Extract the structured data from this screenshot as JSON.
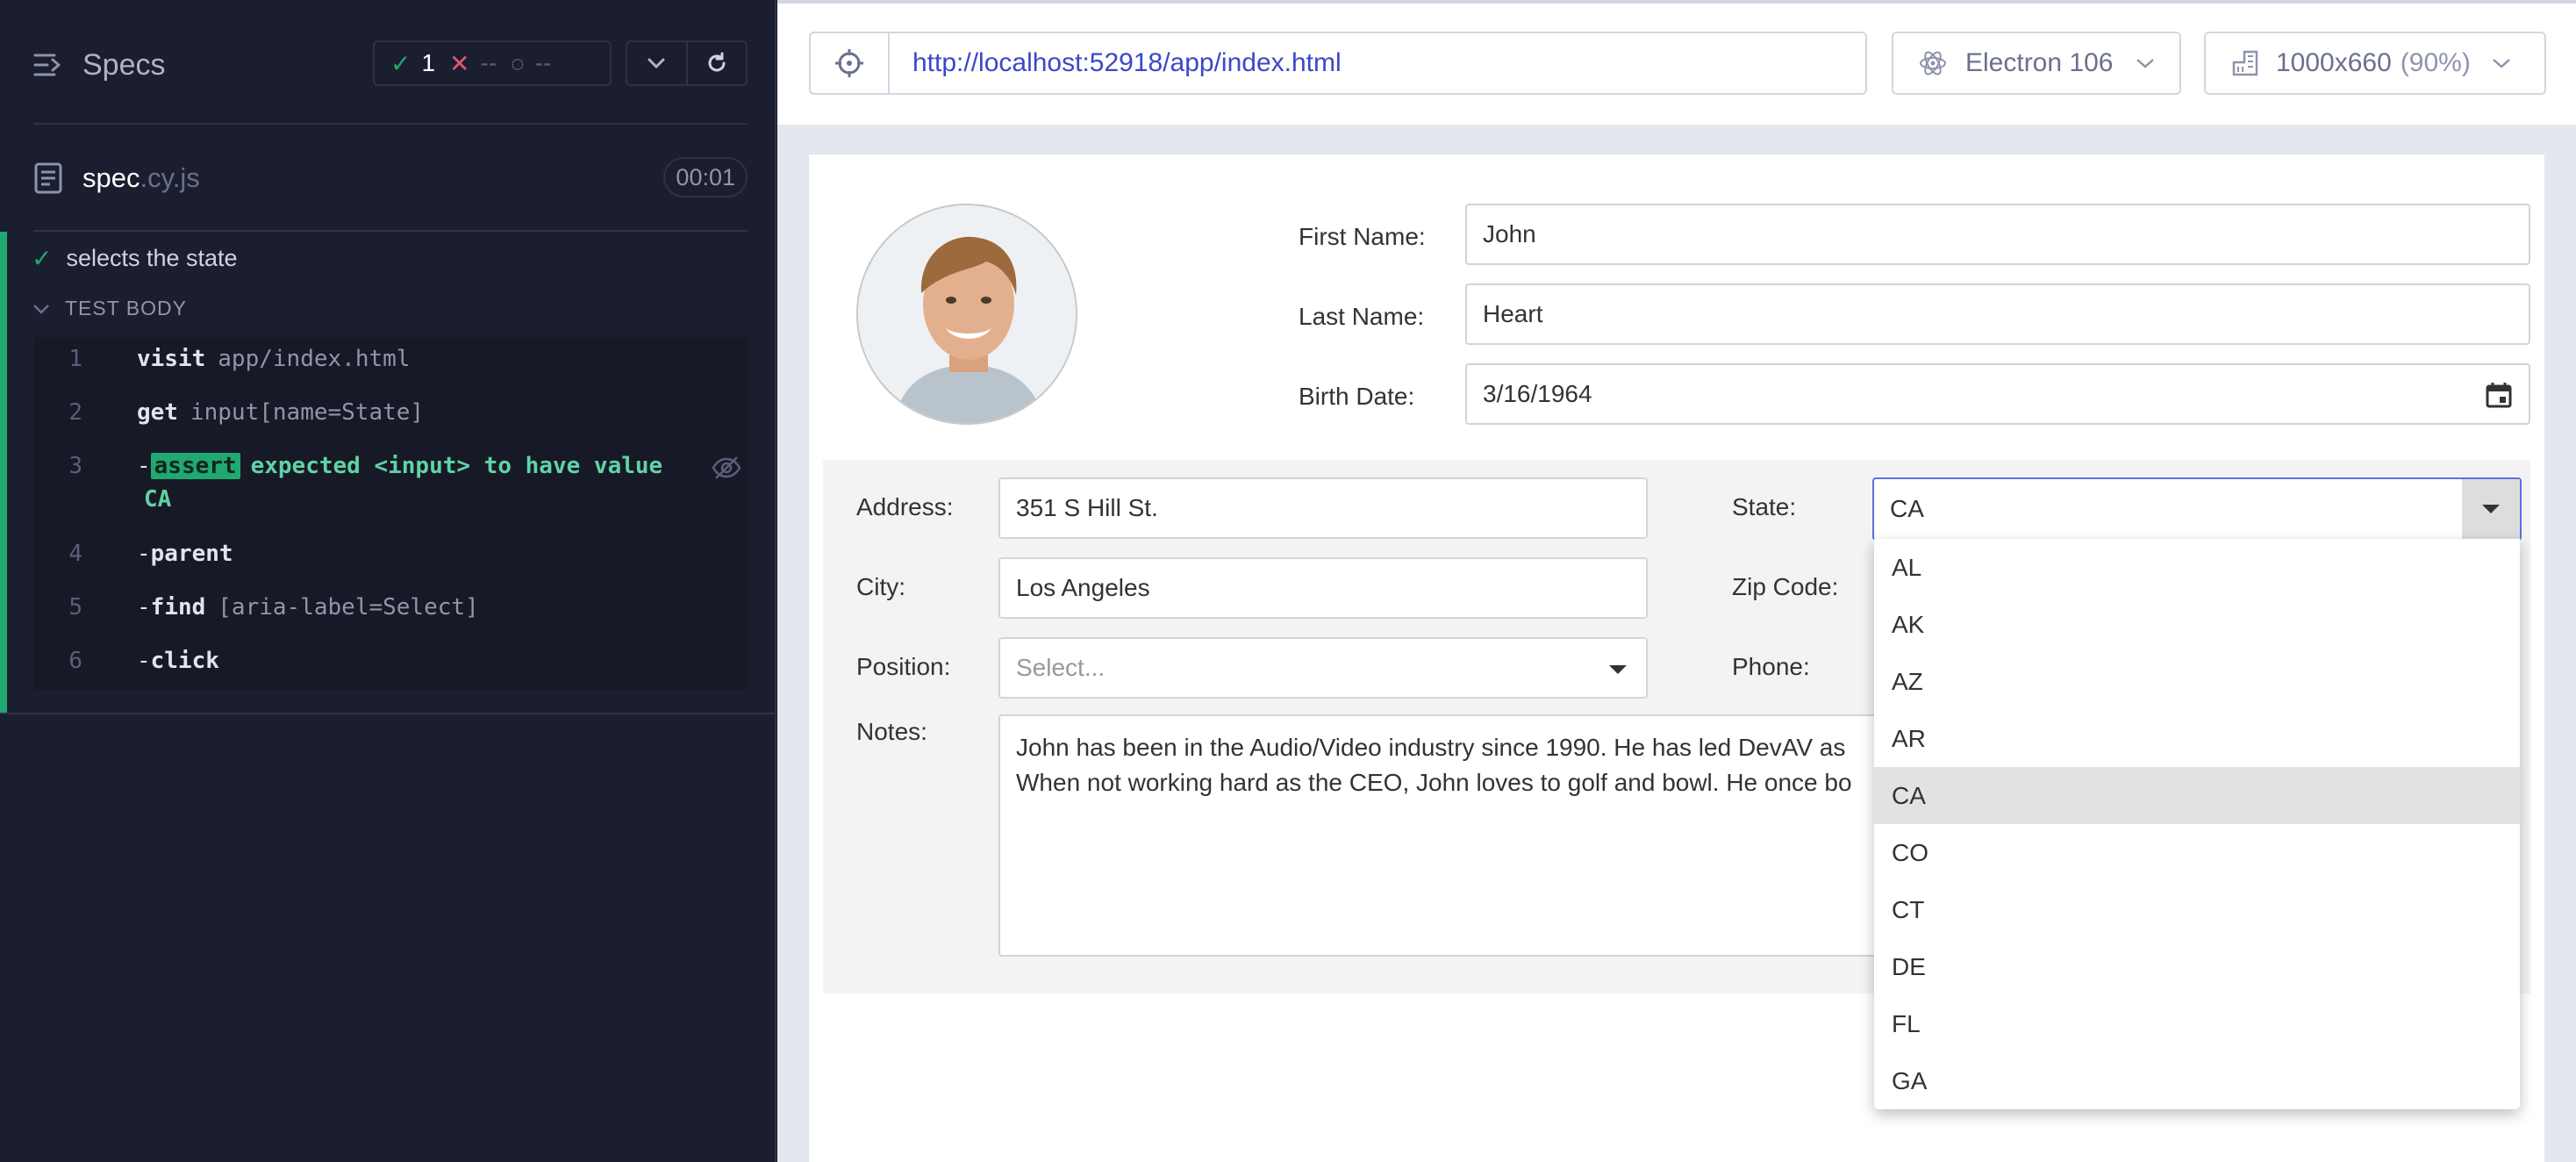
{
  "reporter": {
    "specs_label": "Specs",
    "stats": {
      "passed": "1",
      "failed": "--",
      "pending": "--"
    },
    "spec": {
      "name": "spec",
      "ext": ".cy.js",
      "duration": "00:01"
    },
    "test": {
      "title": "selects the state",
      "body_label": "TEST BODY",
      "commands": [
        {
          "num": "1",
          "name": "visit",
          "message": "app/index.html"
        },
        {
          "num": "2",
          "name": "get",
          "message": "input[name=State]"
        },
        {
          "num": "3",
          "name": "assert",
          "message": "expected <input> to have value",
          "value": "CA"
        },
        {
          "num": "4",
          "name": "parent",
          "message": ""
        },
        {
          "num": "5",
          "name": "find",
          "message": "[aria-label=Select]"
        },
        {
          "num": "6",
          "name": "click",
          "message": ""
        }
      ]
    }
  },
  "aut": {
    "url": "http://localhost:52918/app/index.html",
    "browser": "Electron 106",
    "viewport": "1000x660",
    "scale": "(90%)"
  },
  "form": {
    "first_name_label": "First Name:",
    "first_name": "John",
    "last_name_label": "Last Name:",
    "last_name": "Heart",
    "birth_date_label": "Birth Date:",
    "birth_date": "3/16/1964",
    "address_label": "Address:",
    "address": "351 S Hill St.",
    "city_label": "City:",
    "city": "Los Angeles",
    "position_label": "Position:",
    "position_placeholder": "Select...",
    "state_label": "State:",
    "state": "CA",
    "zip_label": "Zip Code:",
    "phone_label": "Phone:",
    "notes_label": "Notes:",
    "notes_line1": "John has been in the Audio/Video industry since 1990. He has led DevAV as",
    "notes_line2": "When not working hard as the CEO, John loves to golf and bowl. He once bo",
    "state_options": [
      "AL",
      "AK",
      "AZ",
      "AR",
      "CA",
      "CO",
      "CT",
      "DE",
      "FL",
      "GA"
    ],
    "state_selected": "CA"
  },
  "colors": {
    "pass": "#1fa971",
    "fail": "#e45770",
    "url": "#3a48c8",
    "focus": "#5f6fe0"
  }
}
